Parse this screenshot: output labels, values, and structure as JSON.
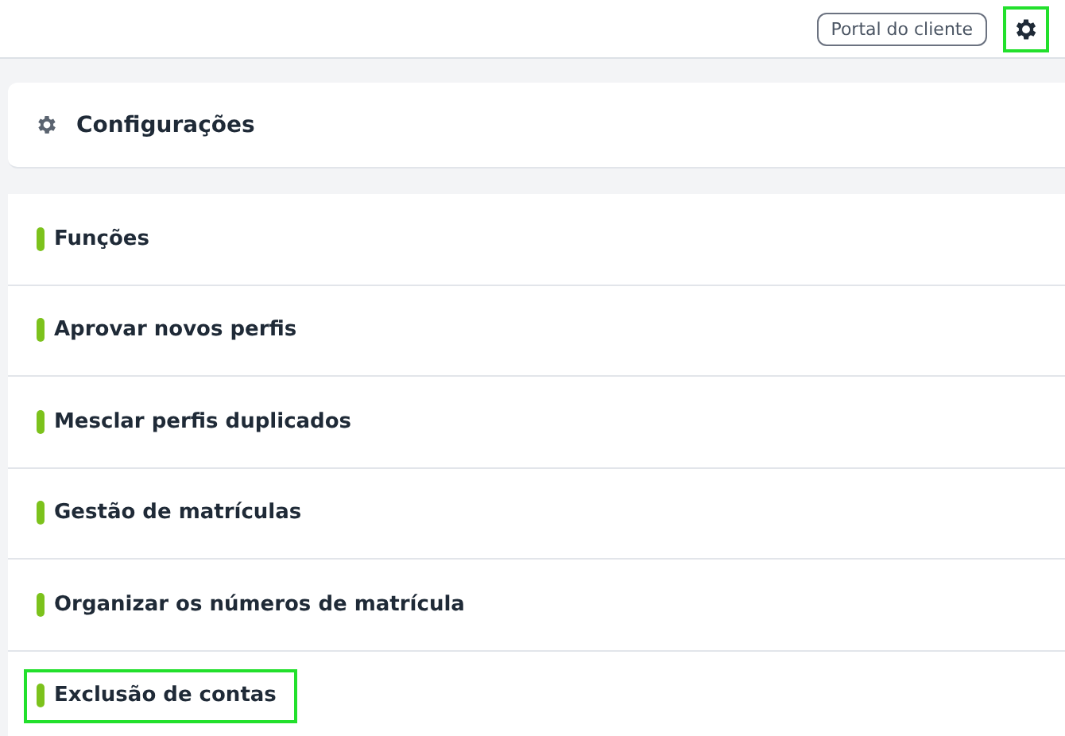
{
  "header": {
    "portal_button": "Portal do cliente",
    "settings_button": {
      "highlighted": true
    }
  },
  "settings_card": {
    "title": "Configurações"
  },
  "items": [
    {
      "label": "Funções",
      "highlighted": false
    },
    {
      "label": "Aprovar novos perfis",
      "highlighted": false
    },
    {
      "label": "Mesclar perfis duplicados",
      "highlighted": false
    },
    {
      "label": "Gestão de matrículas",
      "highlighted": false
    },
    {
      "label": "Organizar os números de matrícula",
      "highlighted": false
    },
    {
      "label": "Exclusão de contas",
      "highlighted": true
    }
  ]
}
